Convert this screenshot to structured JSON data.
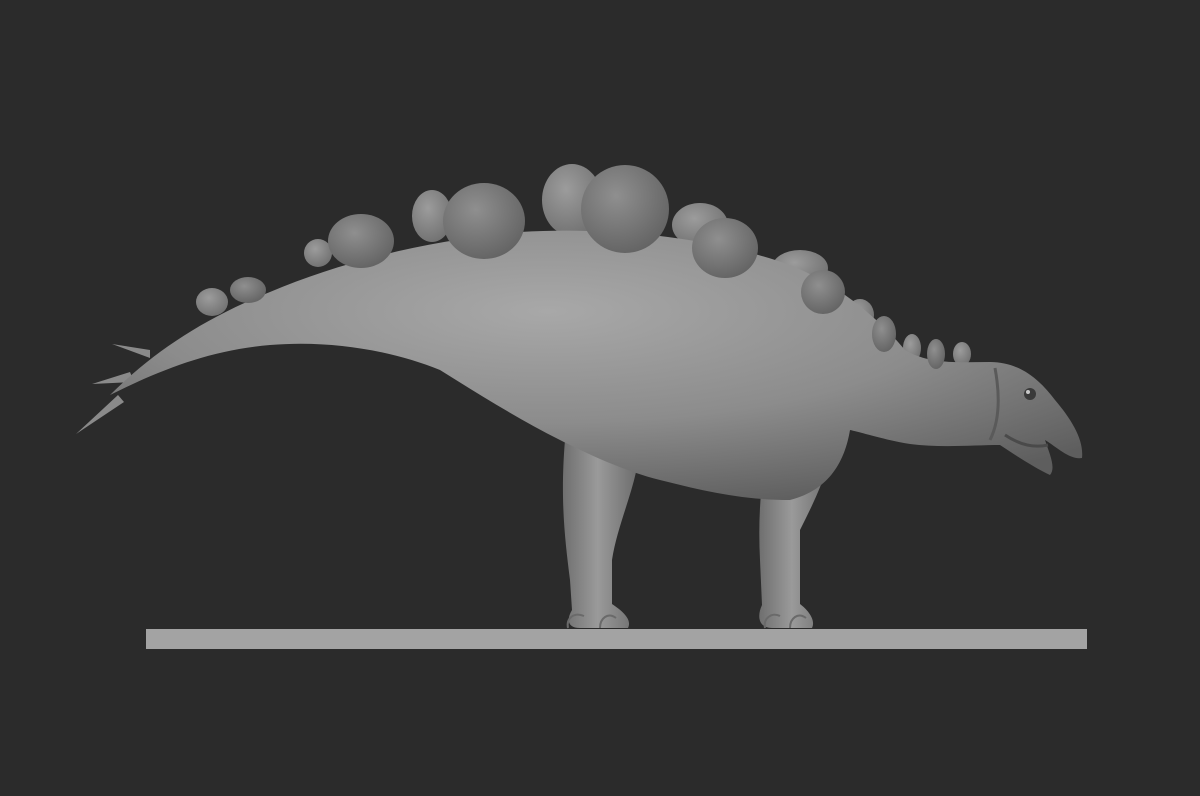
{
  "viewport": {
    "background_color": "#2b2b2b"
  },
  "model": {
    "subject": "stegosaur-sculpt",
    "shading": "matte-gray-clay",
    "body_color": "#8e8e8e",
    "plate_color": "#7d7d7d",
    "base_color": "#a3a3a3"
  }
}
